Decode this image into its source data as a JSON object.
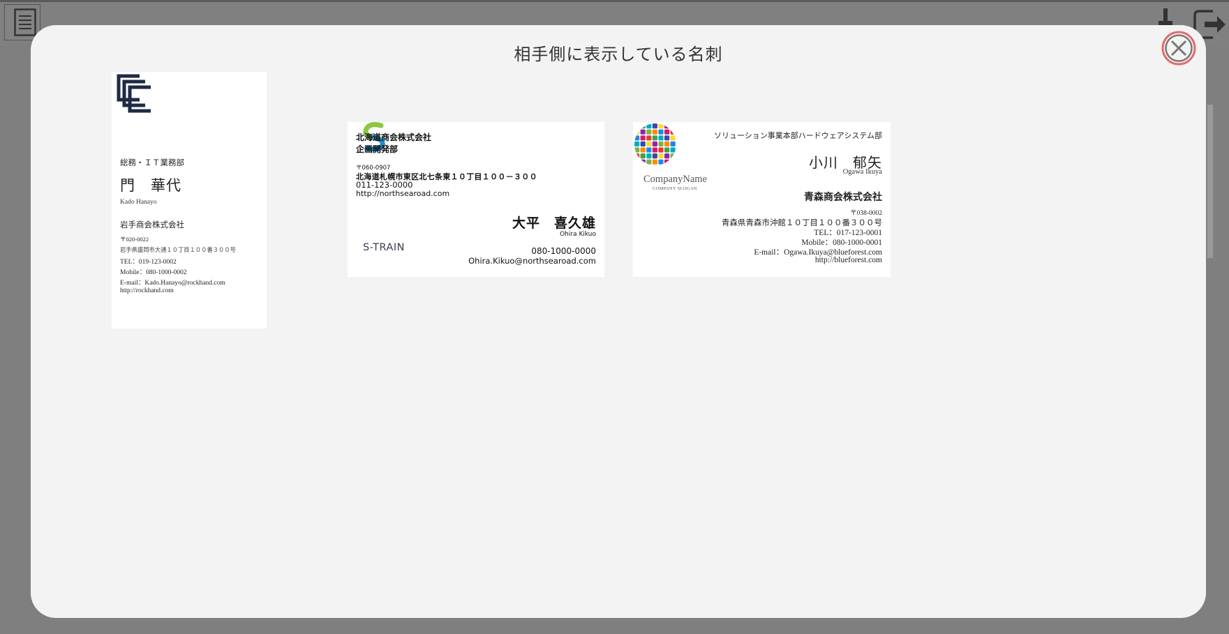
{
  "modal": {
    "title": "相手側に表示している名刺"
  },
  "icons": {
    "menu": "menu-list-icon",
    "pin": "pin-icon",
    "logout": "logout-icon",
    "close": "close-circle-icon"
  },
  "colors": {
    "close_accent": "#e46a6a",
    "overlay": "#7f7f7f",
    "modal_bg": "#f3f3f3",
    "card2_logo_green": "#8dc63f",
    "card2_logo_blue": "#1a8fd6"
  },
  "cards": [
    {
      "department": "総務・ＩＴ業務部",
      "name": "門　華代",
      "romaji": "Kado Hanayo",
      "company": "岩手商会株式会社",
      "postal": "〒020-0022",
      "address": "岩手県盛岡市大通１０丁目１００番３００号",
      "tel": "TEL：019-123-0002",
      "mobile": "Mobile：080-1000-0002",
      "email": "E-mail：Kado.Hanayo@rockhand.com",
      "url": "http://rockhand.com"
    },
    {
      "company": "北海道商会株式会社",
      "department": "企画開発部",
      "postal": "〒060-0907",
      "address": "北海道札幌市東区北七条東１０丁目１００－３００",
      "tel": "011-123-0000",
      "url": "http://northsearoad.com",
      "logo_text": "S-TRAIN",
      "name": "大平　喜久雄",
      "romaji": "Ohira Kikuo",
      "mobile": "080-1000-0000",
      "email": "Ohira.Kikuo@northsearoad.com"
    },
    {
      "logo_name": "CompanyName",
      "logo_slogan": "COMPANY SLOGAN",
      "department": "ソリューション事業本部ハードウェアシステム部",
      "name": "小川　郁矢",
      "romaji": "Ogawa Ikuya",
      "company": "青森商会株式会社",
      "postal": "〒038-0002",
      "address": "青森県青森市沖館１０丁目１００番３００号",
      "tel": "TEL：017-123-0001",
      "mobile": "Mobile：080-1000-0001",
      "email": "E-mail：Ogawa.Ikuya@blueforest.com",
      "url": "http://blueforest.com"
    }
  ]
}
